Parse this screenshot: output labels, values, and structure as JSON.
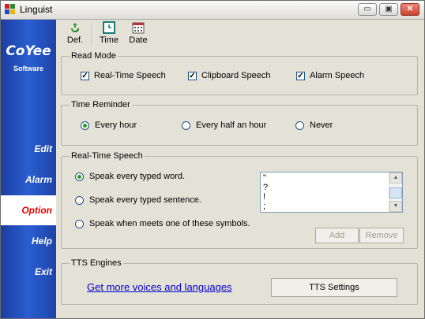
{
  "window": {
    "title": "Linguist",
    "minimize": "▭",
    "restore": "▣",
    "close": "✕"
  },
  "brand": {
    "main": "CoYee",
    "sub": "Software"
  },
  "sidebar": {
    "items": [
      {
        "label": "Edit"
      },
      {
        "label": "Alarm"
      },
      {
        "label": "Option"
      },
      {
        "label": "Help"
      },
      {
        "label": "Exit"
      }
    ],
    "active": "Option"
  },
  "toolbar": {
    "def_label": "Def.",
    "time_label": "Time",
    "date_label": "Date"
  },
  "read_mode": {
    "title": "Read Mode",
    "options": [
      {
        "label": "Real-Time Speech",
        "checked": true
      },
      {
        "label": "Clipboard Speech",
        "checked": true
      },
      {
        "label": "Alarm Speech",
        "checked": true
      }
    ]
  },
  "time_reminder": {
    "title": "Time Reminder",
    "options": [
      {
        "label": "Every hour",
        "selected": true
      },
      {
        "label": "Every half an hour",
        "selected": false
      },
      {
        "label": "Never",
        "selected": false
      }
    ]
  },
  "realtime_speech": {
    "title": "Real-Time Speech",
    "options": [
      {
        "label": "Speak every typed word.",
        "selected": true
      },
      {
        "label": "Speak every typed sentence.",
        "selected": false
      },
      {
        "label": "Speak when meets one of these symbols.",
        "selected": false
      }
    ],
    "symbols": [
      "\"",
      "?",
      "!",
      ";"
    ],
    "add_label": "Add",
    "remove_label": "Remove"
  },
  "tts": {
    "title": "TTS Engines",
    "link_label": "Get more voices and languages",
    "settings_label": "TTS Settings"
  },
  "colors": {
    "sidebar_blue": "#2a5ed1",
    "active_red": "#e60000",
    "link_blue": "#0000cc"
  }
}
